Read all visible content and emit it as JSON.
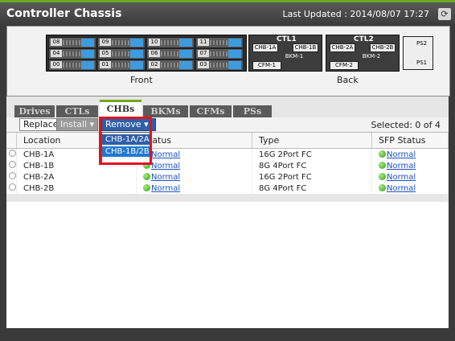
{
  "header": {
    "title": "Controller Chassis",
    "last_updated": "Last Updated : 2014/08/07 17:27",
    "refresh_icon": "refresh-icon"
  },
  "chassis": {
    "front_label": "Front",
    "back_label": "Back",
    "front_slots": [
      "08",
      "09",
      "10",
      "11",
      "04",
      "05",
      "06",
      "07",
      "00",
      "01",
      "02",
      "03"
    ],
    "ctl1": {
      "label": "CTL1",
      "chb_a": "CHB-1A",
      "chb_b": "CHB-1B",
      "bkm": "BKM-1",
      "cfm": "CFM-1"
    },
    "ctl2": {
      "label": "CTL2",
      "chb_a": "CHB-2A",
      "chb_b": "CHB-2B",
      "bkm": "BKM-2",
      "cfm": "CFM-2"
    },
    "ps1": "PS1",
    "ps2": "PS2"
  },
  "tabs": [
    "Drives",
    "CTLs",
    "CHBs",
    "BKMs",
    "CFMs",
    "PSs"
  ],
  "toolbar": {
    "replace": "Replace",
    "install": "Install",
    "remove": "Remove",
    "selected": "Selected: 0 of 4"
  },
  "remove_menu": [
    "CHB-1A/2A",
    "CHB-1B/2B"
  ],
  "table": {
    "headers": [
      "Location",
      "Status",
      "Type",
      "SFP Status"
    ],
    "rows": [
      {
        "location": "CHB-1A",
        "status": "Normal",
        "type": "16G 2Port FC",
        "sfp": "Normal"
      },
      {
        "location": "CHB-1B",
        "status": "Normal",
        "type": "8G 4Port FC",
        "sfp": "Normal"
      },
      {
        "location": "CHB-2A",
        "status": "Normal",
        "type": "16G 2Port FC",
        "sfp": "Normal"
      },
      {
        "location": "CHB-2B",
        "status": "Normal",
        "type": "8G 4Port FC",
        "sfp": "Normal"
      }
    ]
  },
  "colors": {
    "accent": "#6fa820",
    "selection": "#2f5fa8",
    "highlight": "#e0141e"
  }
}
